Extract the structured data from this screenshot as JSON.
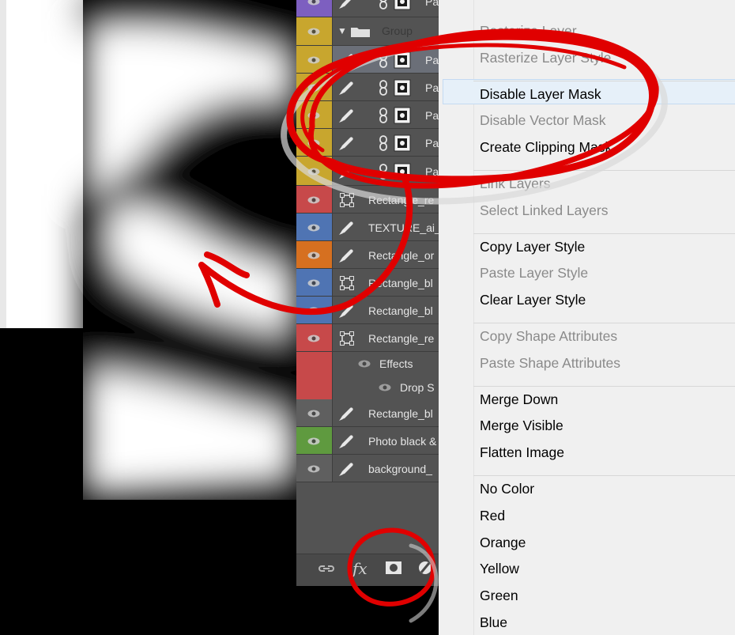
{
  "layers_panel": {
    "layers": [
      {
        "name": "Pa",
        "color": "#7d5fc0",
        "type": "mask"
      },
      {
        "name": "Group",
        "color": "#c8a62e",
        "type": "group"
      },
      {
        "name": "Pa",
        "color": "#c8a62e",
        "type": "mask"
      },
      {
        "name": "Pa",
        "color": "#c8a62e",
        "type": "mask"
      },
      {
        "name": "Pa",
        "color": "#c8a62e",
        "type": "mask"
      },
      {
        "name": "Pa",
        "color": "#c8a62e",
        "type": "mask"
      },
      {
        "name": "Pa",
        "color": "#c8a62e",
        "type": "mask"
      },
      {
        "name": "Rectangle_re",
        "color": "#c7494a",
        "type": "shape"
      },
      {
        "name": "TEXTURE_ai_",
        "color": "#4f74b3",
        "type": "pixel"
      },
      {
        "name": "Rectangle_or",
        "color": "#d67020",
        "type": "pixel"
      },
      {
        "name": "Rectangle_bl",
        "color": "#4f74b3",
        "type": "shape"
      },
      {
        "name": "Rectangle_bl",
        "color": "#4f74b3",
        "type": "pixel"
      },
      {
        "name": "Rectangle_re",
        "color": "#c7494a",
        "type": "shape"
      },
      {
        "name": "Effects",
        "color": "#c7494a",
        "type": "effects"
      },
      {
        "name": "Drop S",
        "color": "#c7494a",
        "type": "effect"
      },
      {
        "name": "Rectangle_bl",
        "color": "#5f5f5f",
        "type": "pixel"
      },
      {
        "name": "Photo black &",
        "color": "#5f9a3f",
        "type": "pixel"
      },
      {
        "name": "background_",
        "color": "#5f5f5f",
        "type": "pixel"
      }
    ],
    "footer_icons": [
      "link-icon",
      "fx-icon",
      "add-mask-icon",
      "adjustment-icon"
    ],
    "fx_label": "fx"
  },
  "context_menu": {
    "items": [
      {
        "label": "Rasterize Layer",
        "enabled": false
      },
      {
        "label": "Rasterize Layer Style",
        "enabled": false
      },
      {
        "separator": true
      },
      {
        "label": "Disable Layer Mask",
        "enabled": true,
        "highlighted": true
      },
      {
        "label": "Disable Vector Mask",
        "enabled": false
      },
      {
        "label": "Create Clipping Mask",
        "enabled": true
      },
      {
        "separator": true
      },
      {
        "label": "Link Layers",
        "enabled": false
      },
      {
        "label": "Select Linked Layers",
        "enabled": false
      },
      {
        "separator": true
      },
      {
        "label": "Copy Layer Style",
        "enabled": true
      },
      {
        "label": "Paste Layer Style",
        "enabled": false
      },
      {
        "label": "Clear Layer Style",
        "enabled": true
      },
      {
        "separator": true
      },
      {
        "label": "Copy Shape Attributes",
        "enabled": false
      },
      {
        "label": "Paste Shape Attributes",
        "enabled": false
      },
      {
        "separator": true
      },
      {
        "label": "Merge Down",
        "enabled": true
      },
      {
        "label": "Merge Visible",
        "enabled": true
      },
      {
        "label": "Flatten Image",
        "enabled": true
      },
      {
        "separator": true
      },
      {
        "label": "No Color",
        "enabled": true
      },
      {
        "label": "Red",
        "enabled": true
      },
      {
        "label": "Orange",
        "enabled": true
      },
      {
        "label": "Yellow",
        "enabled": true
      },
      {
        "label": "Green",
        "enabled": true
      },
      {
        "label": "Blue",
        "enabled": true
      }
    ]
  },
  "colors": {
    "annotation": "#e00000",
    "panel_bg": "#535353",
    "menu_bg": "#f0f0f0",
    "menu_disabled_text": "#8a8a8a",
    "menu_highlight": "#e6f0f9"
  }
}
